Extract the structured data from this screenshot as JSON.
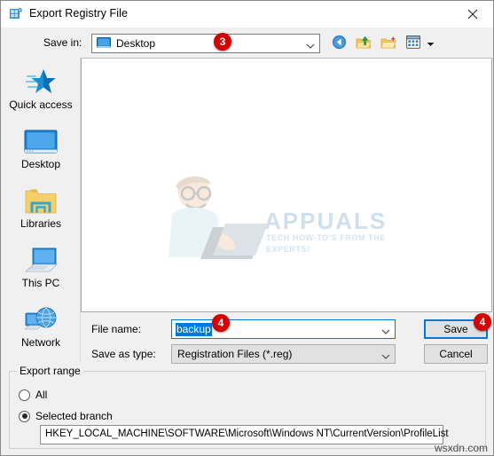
{
  "window": {
    "title": "Export Registry File",
    "icon": "registry-editor-icon",
    "close_label": "✕"
  },
  "savein": {
    "label": "Save in:",
    "value": "Desktop",
    "icon": "desktop-monitor-icon",
    "caret_icon": "chevron-down-icon"
  },
  "toolbar": {
    "back": "back-arrow-icon",
    "up": "up-one-level-icon",
    "new_folder": "new-folder-icon",
    "views": "views-icon",
    "views_caret": "chevron-down-icon"
  },
  "places": [
    {
      "label": "Quick access",
      "icon": "quick-access-star-icon"
    },
    {
      "label": "Desktop",
      "icon": "desktop-monitor-icon"
    },
    {
      "label": "Libraries",
      "icon": "libraries-folder-icon"
    },
    {
      "label": "This PC",
      "icon": "this-pc-laptop-icon"
    },
    {
      "label": "Network",
      "icon": "network-globe-icon"
    }
  ],
  "filelist": {
    "items": [],
    "watermark_title": "APPUALS",
    "watermark_subtitle": "TECH HOW-TO'S FROM THE EXPERTS!"
  },
  "form": {
    "filename_label": "File name:",
    "filename_value": "backup",
    "filetype_label": "Save as type:",
    "filetype_value": "Registration Files (*.reg)",
    "save_label": "Save",
    "cancel_label": "Cancel"
  },
  "export_range": {
    "title": "Export range",
    "options": [
      {
        "label": "All",
        "checked": false
      },
      {
        "label": "Selected branch",
        "checked": true
      }
    ],
    "branch_value": "HKEY_LOCAL_MACHINE\\SOFTWARE\\Microsoft\\Windows NT\\CurrentVersion\\ProfileList"
  },
  "badges": [
    {
      "number": "3"
    },
    {
      "number": "4"
    },
    {
      "number": "4"
    }
  ],
  "site_watermark": "wsxdn.com",
  "colors": {
    "accent": "#0078d7",
    "badge_red": "#d60000",
    "window_bg": "#f0f0f0"
  }
}
